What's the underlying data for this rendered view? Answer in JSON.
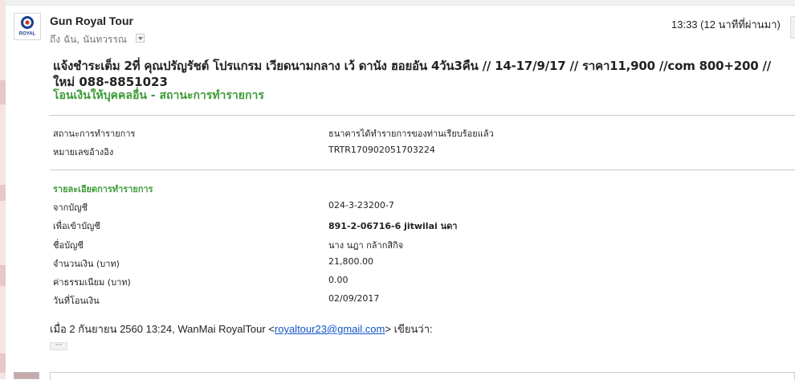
{
  "email": {
    "sender": "Gun Royal Tour",
    "recipients": "ถึง ฉัน, นันทวรรณ",
    "timestamp": "13:33 (12 นาทีที่ผ่านมา)",
    "avatar_label": "ROYAL",
    "subject_line1": "แจ้งชำระเต็ม 2ที่ คุณปรัญรัชต์ โปรแกรม เวียดนามกลาง เว้ ดานัง ฮอยอัน 4วัน3คืน // 14-17/9/17 // ราคา11,900 //com 800+200 //",
    "subject_line2": "ใหม่ 088-8851023",
    "green_title": "โอนเงินให้บุคคลอื่น - สถานะการทำรายการ"
  },
  "status_section": {
    "rows": [
      {
        "label": "สถานะการทำรายการ",
        "value": "ธนาคารได้ทำรายการของท่านเรียบร้อยแล้ว"
      },
      {
        "label": "หมายเลขอ้างอิง",
        "value": "TRTR170902051703224"
      }
    ]
  },
  "details_section": {
    "heading": "รายละเอียดการทำรายการ",
    "rows": [
      {
        "label": "จากบัญชี",
        "value": "024-3-23200-7"
      },
      {
        "label": "เพื่อเข้าบัญชี",
        "value": "891-2-06716-6 jitwilai นดา"
      },
      {
        "label": "ชื่อบัญชี",
        "value": "นาง นฎา กล้ากสิกิจ"
      },
      {
        "label": "จำนวนเงิน (บาท)",
        "value": "21,800.00"
      },
      {
        "label": "ค่าธรรมเนียม (บาท)",
        "value": "0.00"
      },
      {
        "label": "วันที่โอนเงิน",
        "value": "02/09/2017"
      }
    ]
  },
  "quote": {
    "prefix": "เมื่อ 2 กันยายน 2560 13:24, WanMai RoyalTour <",
    "email_link": "royaltour23@gmail.com",
    "suffix": "> เขียนว่า:"
  },
  "ellipsis": "···",
  "colors": {
    "green": "#3b9a36",
    "link": "#1155cc",
    "divider": "#c9c9c9"
  }
}
